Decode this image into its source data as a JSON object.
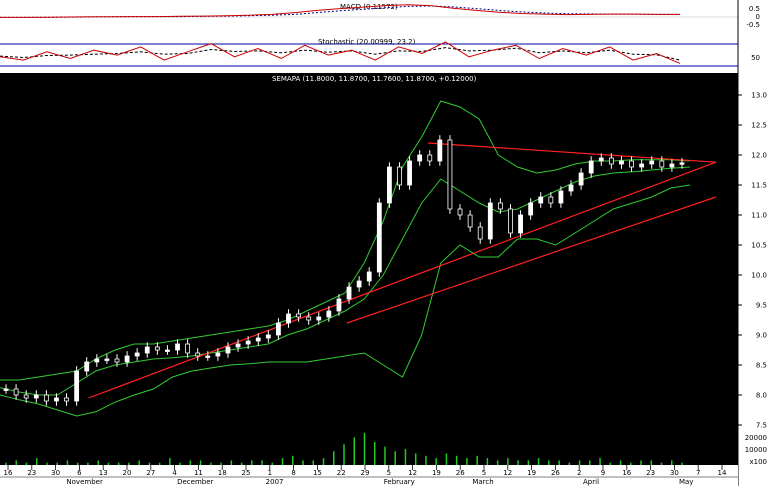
{
  "chart_data": {
    "type": "candlestick",
    "instrument_label": "SEMAPA (11.8000, 11.8700, 11.7600, 11.8700, +0.12000)",
    "macd": {
      "label": "MACD (0.11572)",
      "yticks": [
        "0.5",
        "0",
        "-0.5"
      ],
      "macd_line": [
        -0.02,
        -0.02,
        -0.01,
        0.0,
        0.01,
        0.01,
        0.02,
        0.02,
        0.03,
        0.04,
        0.06,
        0.08,
        0.12,
        0.2,
        0.3,
        0.38,
        0.45,
        0.52,
        0.56,
        0.52,
        0.4,
        0.3,
        0.22,
        0.16,
        0.13,
        0.11,
        0.12,
        0.13,
        0.13,
        0.12,
        0.12
      ],
      "signal_line": [
        -0.02,
        -0.02,
        -0.02,
        -0.01,
        0.0,
        0.01,
        0.01,
        0.02,
        0.02,
        0.03,
        0.04,
        0.06,
        0.08,
        0.12,
        0.2,
        0.28,
        0.35,
        0.42,
        0.48,
        0.5,
        0.46,
        0.38,
        0.3,
        0.23,
        0.18,
        0.15,
        0.14,
        0.13,
        0.13,
        0.12,
        0.12
      ]
    },
    "stochastic": {
      "label": "Stochastic (20.00999, 23.2)",
      "yticks": [
        "50"
      ],
      "k_line": [
        40,
        30,
        55,
        35,
        60,
        45,
        70,
        30,
        55,
        80,
        40,
        65,
        35,
        75,
        45,
        60,
        30,
        70,
        50,
        85,
        40,
        60,
        75,
        35,
        65,
        45,
        70,
        30,
        50,
        20
      ],
      "d_line": [
        42,
        38,
        44,
        45,
        48,
        50,
        55,
        48,
        50,
        62,
        56,
        58,
        52,
        60,
        54,
        58,
        48,
        58,
        56,
        68,
        58,
        60,
        66,
        52,
        58,
        52,
        60,
        48,
        46,
        30
      ]
    },
    "price": {
      "ylim": [
        7.25,
        13.25
      ],
      "yticks": [
        "13.0",
        "12.5",
        "12.0",
        "11.5",
        "11.0",
        "10.5",
        "10.0",
        "9.5",
        "9.0",
        "8.5",
        "8.0",
        "7.5"
      ],
      "volume_ticks": [
        "20000",
        "10000",
        "x100"
      ],
      "close": [
        8.1,
        8.0,
        7.95,
        8.0,
        7.9,
        7.95,
        7.9,
        8.4,
        8.55,
        8.6,
        8.6,
        8.55,
        8.65,
        8.7,
        8.8,
        8.75,
        8.75,
        8.85,
        8.7,
        8.65,
        8.65,
        8.7,
        8.8,
        8.85,
        8.9,
        8.95,
        9.0,
        9.2,
        9.35,
        9.3,
        9.25,
        9.3,
        9.4,
        9.6,
        9.8,
        9.9,
        10.05,
        11.2,
        11.8,
        11.5,
        11.9,
        12.0,
        11.9,
        12.25,
        11.1,
        11.0,
        10.8,
        10.6,
        11.2,
        11.1,
        10.7,
        11.0,
        11.2,
        11.3,
        11.2,
        11.4,
        11.5,
        11.7,
        11.9,
        11.95,
        11.85,
        11.9,
        11.8,
        11.85,
        11.9,
        11.8,
        11.85,
        11.87
      ],
      "upper_band": [
        8.25,
        8.25,
        8.3,
        8.35,
        8.4,
        8.6,
        8.75,
        8.85,
        8.85,
        8.9,
        8.95,
        9.0,
        9.05,
        9.1,
        9.15,
        9.25,
        9.4,
        9.55,
        9.7,
        10.2,
        10.9,
        11.8,
        12.3,
        12.9,
        12.8,
        12.6,
        12.0,
        11.8,
        11.7,
        11.75,
        11.85,
        11.9,
        11.9,
        11.92,
        11.92,
        11.92,
        11.9
      ],
      "middle_band": [
        8.12,
        8.05,
        8.0,
        8.0,
        8.2,
        8.4,
        8.5,
        8.55,
        8.6,
        8.62,
        8.65,
        8.7,
        8.75,
        8.8,
        8.85,
        9.0,
        9.1,
        9.25,
        9.4,
        9.6,
        10.0,
        10.6,
        11.2,
        11.6,
        11.4,
        11.2,
        11.05,
        11.1,
        11.25,
        11.4,
        11.55,
        11.65,
        11.7,
        11.72,
        11.75,
        11.78,
        11.8
      ],
      "lower_band": [
        8.0,
        7.92,
        7.85,
        7.75,
        7.65,
        7.72,
        7.88,
        8.0,
        8.1,
        8.3,
        8.4,
        8.45,
        8.5,
        8.52,
        8.55,
        8.55,
        8.55,
        8.6,
        8.65,
        8.7,
        8.5,
        8.3,
        9.0,
        10.2,
        10.5,
        10.3,
        10.3,
        10.6,
        10.6,
        10.5,
        10.7,
        10.9,
        11.1,
        11.2,
        11.3,
        11.45,
        11.5
      ],
      "trendlines": [
        {
          "name": "upper",
          "from": [
            0.58,
            12.2
          ],
          "to": [
            0.97,
            11.88
          ]
        },
        {
          "name": "mid",
          "from": [
            0.12,
            7.95
          ],
          "to": [
            0.97,
            11.88
          ]
        },
        {
          "name": "lower",
          "from": [
            0.47,
            9.2
          ],
          "to": [
            0.97,
            11.3
          ]
        }
      ]
    },
    "volume": [
      1,
      2,
      1,
      3,
      1,
      1,
      2,
      1,
      1,
      2,
      1,
      1,
      1,
      2,
      1,
      1,
      3,
      1,
      2,
      2,
      1,
      1,
      2,
      1,
      2,
      2,
      1,
      3,
      4,
      2,
      2,
      3,
      6,
      9,
      12,
      14,
      10,
      8,
      6,
      7,
      5,
      4,
      3,
      5,
      4,
      3,
      4,
      3,
      2,
      3,
      2,
      2,
      3,
      2,
      2,
      1,
      2,
      2,
      3,
      1,
      2,
      1,
      2,
      2,
      1,
      2,
      1
    ],
    "xaxis": {
      "day_ticks": [
        "16",
        "23",
        "30",
        "6",
        "13",
        "20",
        "27",
        "4",
        "11",
        "18",
        "25",
        "1",
        "8",
        "15",
        "22",
        "29",
        "5",
        "12",
        "19",
        "26",
        "5",
        "12",
        "19",
        "26",
        "2",
        "9",
        "16",
        "23",
        "30",
        "7",
        "14"
      ],
      "month_labels": [
        "November",
        "December",
        "2007",
        "February",
        "March",
        "April",
        "May"
      ]
    }
  }
}
